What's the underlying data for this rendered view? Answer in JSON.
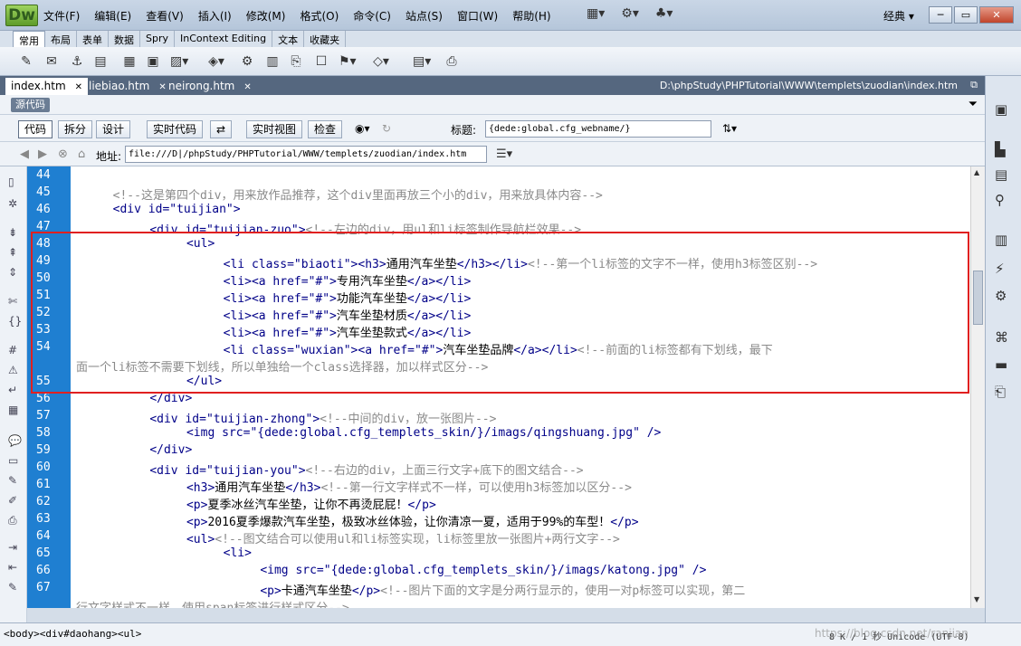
{
  "app": {
    "logo": "Dw",
    "workspace": "经典 ▾",
    "menu": [
      "文件(F)",
      "编辑(E)",
      "查看(V)",
      "插入(I)",
      "修改(M)",
      "格式(O)",
      "命令(C)",
      "站点(S)",
      "窗口(W)",
      "帮助(H)"
    ],
    "window_buttons": [
      "─",
      "▭",
      "✕"
    ]
  },
  "insert_tabs": [
    "常用",
    "布局",
    "表单",
    "数据",
    "Spry",
    "InContext Editing",
    "文本",
    "收藏夹"
  ],
  "doc_tabs": [
    "index.htm",
    "liebiao.htm",
    "neirong.htm"
  ],
  "doc_path": "D:\\phpStudy\\PHPTutorial\\WWW\\templets\\zuodian\\index.htm",
  "source_button": "源代码",
  "view_toolbar": {
    "code": "代码",
    "split": "拆分",
    "design": "设计",
    "live_code": "实时代码",
    "live_view": "实时视图",
    "inspect": "检查",
    "title_label": "标题:",
    "title_value": "{dede:global.cfg_webname/}"
  },
  "address": {
    "label": "地址:",
    "value": "file:///D|/phpStudy/PHPTutorial/WWW/templets/zuodian/index.htm"
  },
  "code_lines": [
    {
      "n": "44",
      "segs": []
    },
    {
      "n": "45",
      "indent": 4,
      "segs": [
        [
          "cm",
          "<!--这是第四个div，用来放作品推荐，这个div里面再放三个小的div，用来放具体内容-->"
        ]
      ]
    },
    {
      "n": "46",
      "indent": 4,
      "segs": [
        [
          "tag",
          "<div id="
        ],
        [
          "val",
          "\"tuijian\""
        ],
        [
          "tag",
          ">"
        ]
      ]
    },
    {
      "n": "47",
      "indent": 8,
      "segs": [
        [
          "tag",
          "<div id="
        ],
        [
          "val",
          "\"tuijian-zuo\""
        ],
        [
          "tag",
          ">"
        ],
        [
          "cm",
          "<!--左边的div，用ul和li标签制作导航栏效果-->"
        ]
      ]
    },
    {
      "n": "48",
      "indent": 12,
      "segs": [
        [
          "tag",
          "<ul>"
        ]
      ]
    },
    {
      "n": "49",
      "indent": 16,
      "segs": [
        [
          "tag",
          "<li class="
        ],
        [
          "val",
          "\"biaoti\""
        ],
        [
          "tag",
          "><h3>"
        ],
        [
          "tx",
          "通用汽车坐垫"
        ],
        [
          "tag",
          "</h3></li>"
        ],
        [
          "cm",
          "<!--第一个li标签的文字不一样，使用h3标签区别-->"
        ]
      ]
    },
    {
      "n": "50",
      "indent": 16,
      "segs": [
        [
          "tag",
          "<li><a href="
        ],
        [
          "val",
          "\"#\""
        ],
        [
          "tag",
          ">"
        ],
        [
          "tx",
          "专用汽车坐垫"
        ],
        [
          "tag",
          "</a></li>"
        ]
      ]
    },
    {
      "n": "51",
      "indent": 16,
      "segs": [
        [
          "tag",
          "<li><a href="
        ],
        [
          "val",
          "\"#\""
        ],
        [
          "tag",
          ">"
        ],
        [
          "tx",
          "功能汽车坐垫"
        ],
        [
          "tag",
          "</a></li>"
        ]
      ]
    },
    {
      "n": "52",
      "indent": 16,
      "segs": [
        [
          "tag",
          "<li><a href="
        ],
        [
          "val",
          "\"#\""
        ],
        [
          "tag",
          ">"
        ],
        [
          "tx",
          "汽车坐垫材质"
        ],
        [
          "tag",
          "</a></li>"
        ]
      ]
    },
    {
      "n": "53",
      "indent": 16,
      "segs": [
        [
          "tag",
          "<li><a href="
        ],
        [
          "val",
          "\"#\""
        ],
        [
          "tag",
          ">"
        ],
        [
          "tx",
          "汽车坐垫款式"
        ],
        [
          "tag",
          "</a></li>"
        ]
      ]
    },
    {
      "n": "54",
      "indent": 16,
      "segs": [
        [
          "tag",
          "<li class="
        ],
        [
          "val",
          "\"wuxian\""
        ],
        [
          "tag",
          "><a href="
        ],
        [
          "val",
          "\"#\""
        ],
        [
          "tag",
          ">"
        ],
        [
          "tx",
          "汽车坐垫品牌"
        ],
        [
          "tag",
          "</a></li>"
        ],
        [
          "cm",
          "<!--前面的li标签都有下划线，最下"
        ]
      ]
    },
    {
      "n": "",
      "indent": 0,
      "segs": [
        [
          "cm",
          "面一个li标签不需要下划线，所以单独给一个class选择器，加以样式区分-->"
        ]
      ]
    },
    {
      "n": "55",
      "indent": 12,
      "segs": [
        [
          "tag",
          "</ul>"
        ]
      ]
    },
    {
      "n": "56",
      "indent": 8,
      "segs": [
        [
          "tag",
          "</div>"
        ]
      ]
    },
    {
      "n": "57",
      "indent": 8,
      "segs": [
        [
          "tag",
          "<div id="
        ],
        [
          "val",
          "\"tuijian-zhong\""
        ],
        [
          "tag",
          ">"
        ],
        [
          "cm",
          "<!--中间的div，放一张图片-->"
        ]
      ]
    },
    {
      "n": "58",
      "indent": 12,
      "segs": [
        [
          "tag",
          "<img src="
        ],
        [
          "val",
          "\"{dede:global.cfg_templets_skin/}/imags/qingshuang.jpg\""
        ],
        [
          "tag",
          " />"
        ]
      ]
    },
    {
      "n": "59",
      "indent": 8,
      "segs": [
        [
          "tag",
          "</div>"
        ]
      ]
    },
    {
      "n": "60",
      "indent": 8,
      "segs": [
        [
          "tag",
          "<div id="
        ],
        [
          "val",
          "\"tuijian-you\""
        ],
        [
          "tag",
          ">"
        ],
        [
          "cm",
          "<!--右边的div，上面三行文字+底下的图文结合-->"
        ]
      ]
    },
    {
      "n": "61",
      "indent": 12,
      "segs": [
        [
          "tag",
          "<h3>"
        ],
        [
          "tx",
          "通用汽车坐垫"
        ],
        [
          "tag",
          "</h3>"
        ],
        [
          "cm",
          "<!--第一行文字样式不一样，可以使用h3标签加以区分-->"
        ]
      ]
    },
    {
      "n": "62",
      "indent": 12,
      "segs": [
        [
          "tag",
          "<p>"
        ],
        [
          "tx",
          "夏季冰丝汽车坐垫，让你不再烫屁屁！"
        ],
        [
          "tag",
          "</p>"
        ]
      ]
    },
    {
      "n": "63",
      "indent": 12,
      "segs": [
        [
          "tag",
          "<p>"
        ],
        [
          "tx",
          "2016夏季爆款汽车坐垫，极致冰丝体验，让你清凉一夏，适用于99%的车型！"
        ],
        [
          "tag",
          "</p>"
        ]
      ]
    },
    {
      "n": "64",
      "indent": 12,
      "segs": [
        [
          "tag",
          "<ul>"
        ],
        [
          "cm",
          "<!--图文结合可以使用ul和li标签实现，li标签里放一张图片+两行文字-->"
        ]
      ]
    },
    {
      "n": "65",
      "indent": 16,
      "segs": [
        [
          "tag",
          "<li>"
        ]
      ]
    },
    {
      "n": "66",
      "indent": 20,
      "segs": [
        [
          "tag",
          "<img src="
        ],
        [
          "val",
          "\"{dede:global.cfg_templets_skin/}/imags/katong.jpg\""
        ],
        [
          "tag",
          " />"
        ]
      ]
    },
    {
      "n": "67",
      "indent": 20,
      "segs": [
        [
          "tag",
          "<p>"
        ],
        [
          "tx",
          "卡通汽车坐垫"
        ],
        [
          "tag",
          "</p>"
        ],
        [
          "cm",
          "<!--图片下面的文字是分两行显示的，使用一对p标签可以实现，第二"
        ]
      ]
    },
    {
      "n": "",
      "indent": 0,
      "segs": [
        [
          "cm",
          "行文字样式不一样，使用span标签进行样式区分-->"
        ]
      ]
    }
  ],
  "status": {
    "tag_selector": "<body><div#daohang><ul>",
    "info": "8 K / 1 秒 Unicode (UTF-8)",
    "watermark": "https://blog.csdn.net/ranjian"
  }
}
